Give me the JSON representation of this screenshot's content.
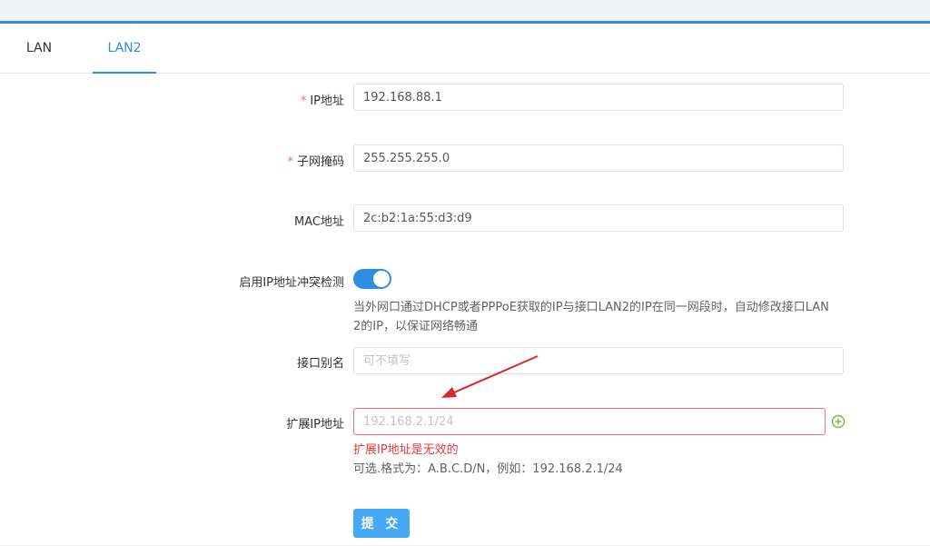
{
  "tabs": [
    {
      "label": "LAN",
      "active": false
    },
    {
      "label": "LAN2",
      "active": true
    }
  ],
  "form": {
    "ip": {
      "label": "IP地址",
      "required": true,
      "value": "192.168.88.1"
    },
    "mask": {
      "label": "子网掩码",
      "required": true,
      "value": "255.255.255.0"
    },
    "mac": {
      "label": "MAC地址",
      "value": "2c:b2:1a:55:d3:d9"
    },
    "conflict": {
      "label": "启用IP地址冲突检测",
      "enabled": true,
      "help_line1": "当外网口通过DHCP或者PPPoE获取的IP与接口LAN2的IP在同一网段时，自动修改接口LAN",
      "help_line2": "2的IP，以保证网络畅通"
    },
    "alias": {
      "label": "接口别名",
      "placeholder": "可不填写",
      "value": ""
    },
    "ext_ip": {
      "label": "扩展IP地址",
      "placeholder": "192.168.2.1/24",
      "value": "",
      "error": "扩展IP地址是无效的",
      "hint": "可选.格式为：A.B.C.D/N，例如：192.168.2.1/24"
    },
    "submit_label": "提 交"
  },
  "colors": {
    "accent": "#2f8de4",
    "error": "#e5393a",
    "add_icon": "#67c23a",
    "annotation_arrow": "#d9272e"
  },
  "icons": {
    "add": "plus-circle-icon",
    "annotation": "red-arrow"
  }
}
